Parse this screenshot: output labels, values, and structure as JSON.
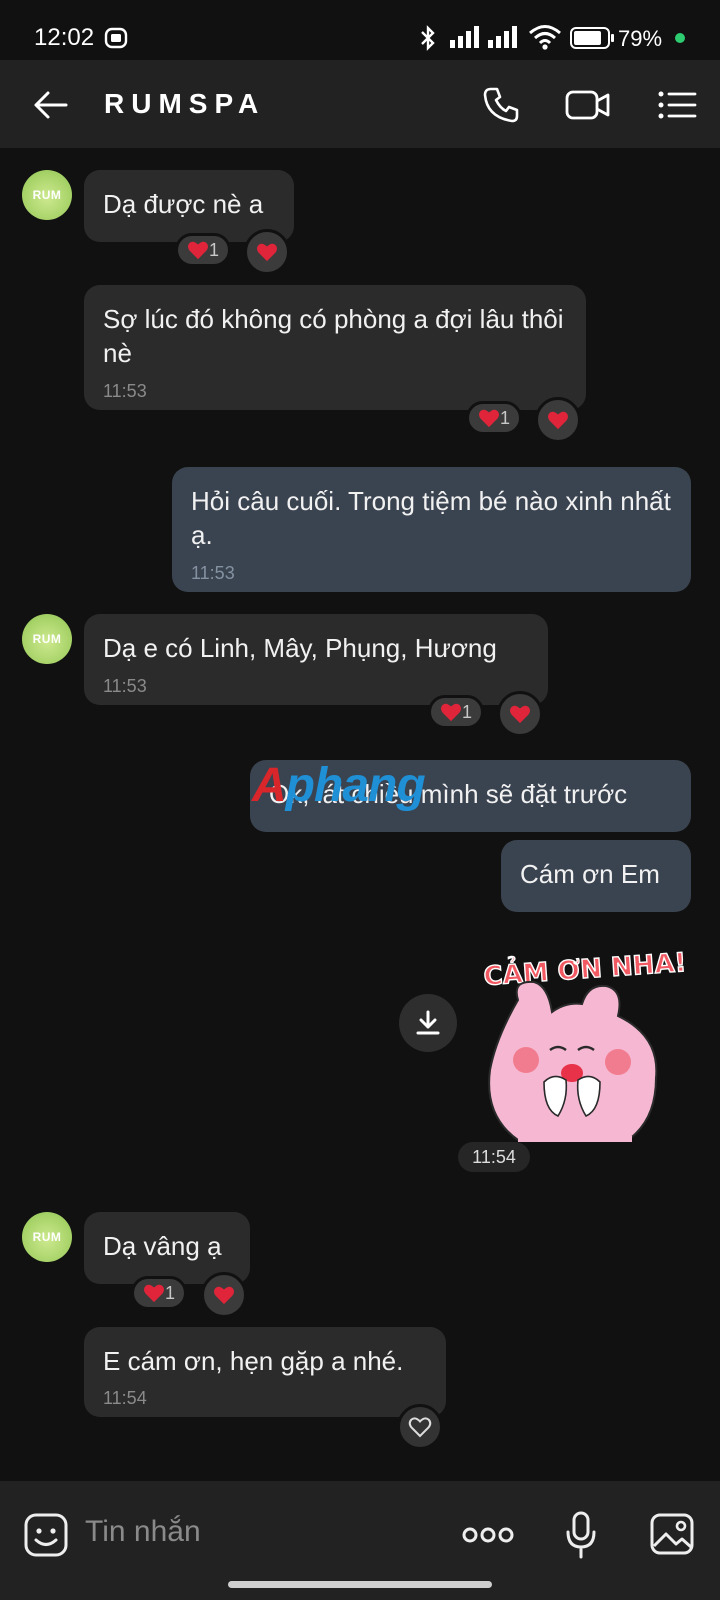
{
  "status_bar": {
    "time": "12:02",
    "battery": "79%",
    "battery_level": 0.79
  },
  "header": {
    "title": "RUMSPA",
    "icons": [
      "back-arrow-icon",
      "phone-icon",
      "video-call-icon",
      "menu-list-icon"
    ]
  },
  "avatar_text": "RUM",
  "messages": [
    {
      "side": "in",
      "text": "Dạ được nè a",
      "time": "",
      "reaction_count": "1"
    },
    {
      "side": "in",
      "text": "Sợ lúc đó không có phòng a đợi lâu thôi nè",
      "time": "11:53",
      "reaction_count": "1"
    },
    {
      "side": "out",
      "text": "Hỏi câu cuối. Trong tiệm bé nào xinh nhất ạ.",
      "time": "11:53"
    },
    {
      "side": "in",
      "text": "Dạ e có Linh, Mây, Phụng, Hương",
      "time": "11:53",
      "reaction_count": "1"
    },
    {
      "side": "out",
      "text": "Ok, lát chiều mình sẽ đặt trước",
      "time": ""
    },
    {
      "side": "out",
      "text": "Cám ơn Em",
      "time": ""
    },
    {
      "side": "in",
      "text": "Dạ vâng ạ",
      "time": "",
      "reaction_count": "1"
    },
    {
      "side": "in",
      "text": "E cám ơn, hẹn gặp a nhé.",
      "time": "11:54"
    }
  ],
  "sticker": {
    "caption": "CẢM ƠN NHA!",
    "time": "11:54"
  },
  "watermark": {
    "part1": "A",
    "part2": "phang"
  },
  "composer": {
    "placeholder": "Tin nhắn"
  },
  "colors": {
    "background": "#111111",
    "incoming_bubble": "#2b2b2b",
    "outgoing_bubble": "#3a4350",
    "heart": "#e0243a",
    "accent_green": "#2ecc71"
  }
}
